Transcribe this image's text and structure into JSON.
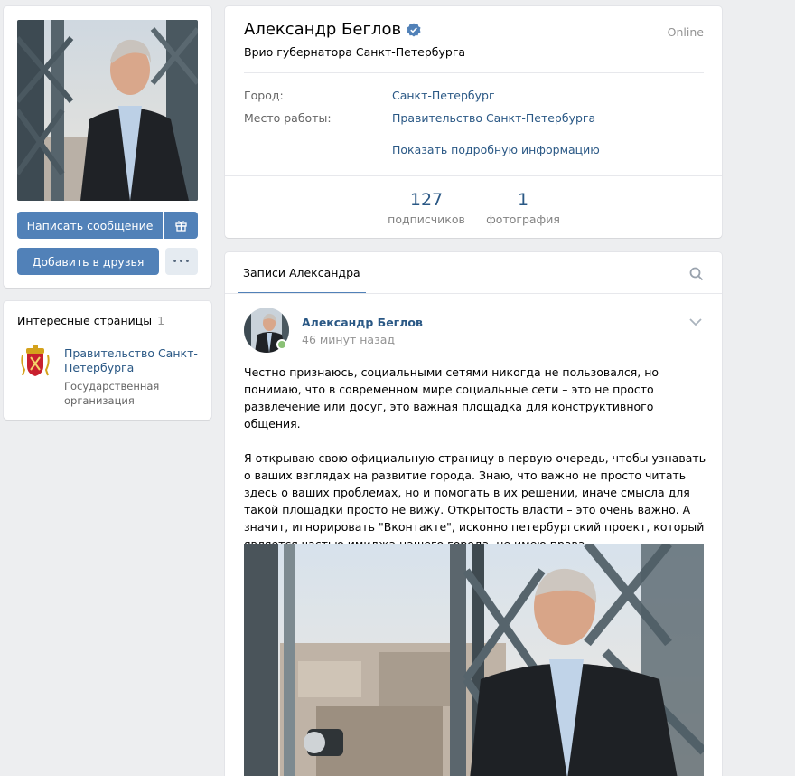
{
  "sidebar": {
    "buttons": {
      "message": "Написать сообщение",
      "add_friend": "Добавить в друзья",
      "more": "•••"
    },
    "interesting": {
      "title": "Интересные страницы",
      "count": "1",
      "items": [
        {
          "name": "Правительство Санкт-Петербурга",
          "description": "Государственная организация"
        }
      ]
    }
  },
  "profile": {
    "name": "Александр Беглов",
    "online": "Online",
    "status": "Врио губернатора Санкт-Петербурга",
    "info": [
      {
        "label": "Город:",
        "value": "Санкт-Петербург"
      },
      {
        "label": "Место работы:",
        "value": "Правительство Санкт-Петербурга"
      }
    ],
    "show_more": "Показать подробную информацию",
    "counters": [
      {
        "number": "127",
        "label": "подписчиков"
      },
      {
        "number": "1",
        "label": "фотография"
      }
    ]
  },
  "wall": {
    "tab": "Записи Александра",
    "post": {
      "author": "Александр Беглов",
      "time": "46 минут назад",
      "paragraphs": [
        "Честно признаюсь, социальными сетями никогда не пользовался, но понимаю, что в современном мире социальные сети – это не просто развлечение или досуг, это важная площадка для конструктивного общения.",
        "Я открываю свою официальную страницу в первую очередь, чтобы узнавать о ваших взглядах на развитие города. Знаю, что важно не просто читать здесь о ваших проблемах, но и помогать в их решении, иначе смысла для такой площадки просто не вижу. Открытость власти – это очень важно. А значит, игнорировать \"Вконтакте\", исконно петербургский проект, который является частью имиджа нашего города, не имею права."
      ]
    }
  },
  "colors": {
    "accent": "#5181b8",
    "link": "#2a5885",
    "background": "#edeef0",
    "online_dot": "#8ac176"
  },
  "icons": {
    "verified": "verified-check-icon",
    "gift": "gift-icon",
    "search": "search-icon",
    "chevron": "chevron-down-icon",
    "coat_of_arms": "spb-coat-of-arms-icon"
  }
}
